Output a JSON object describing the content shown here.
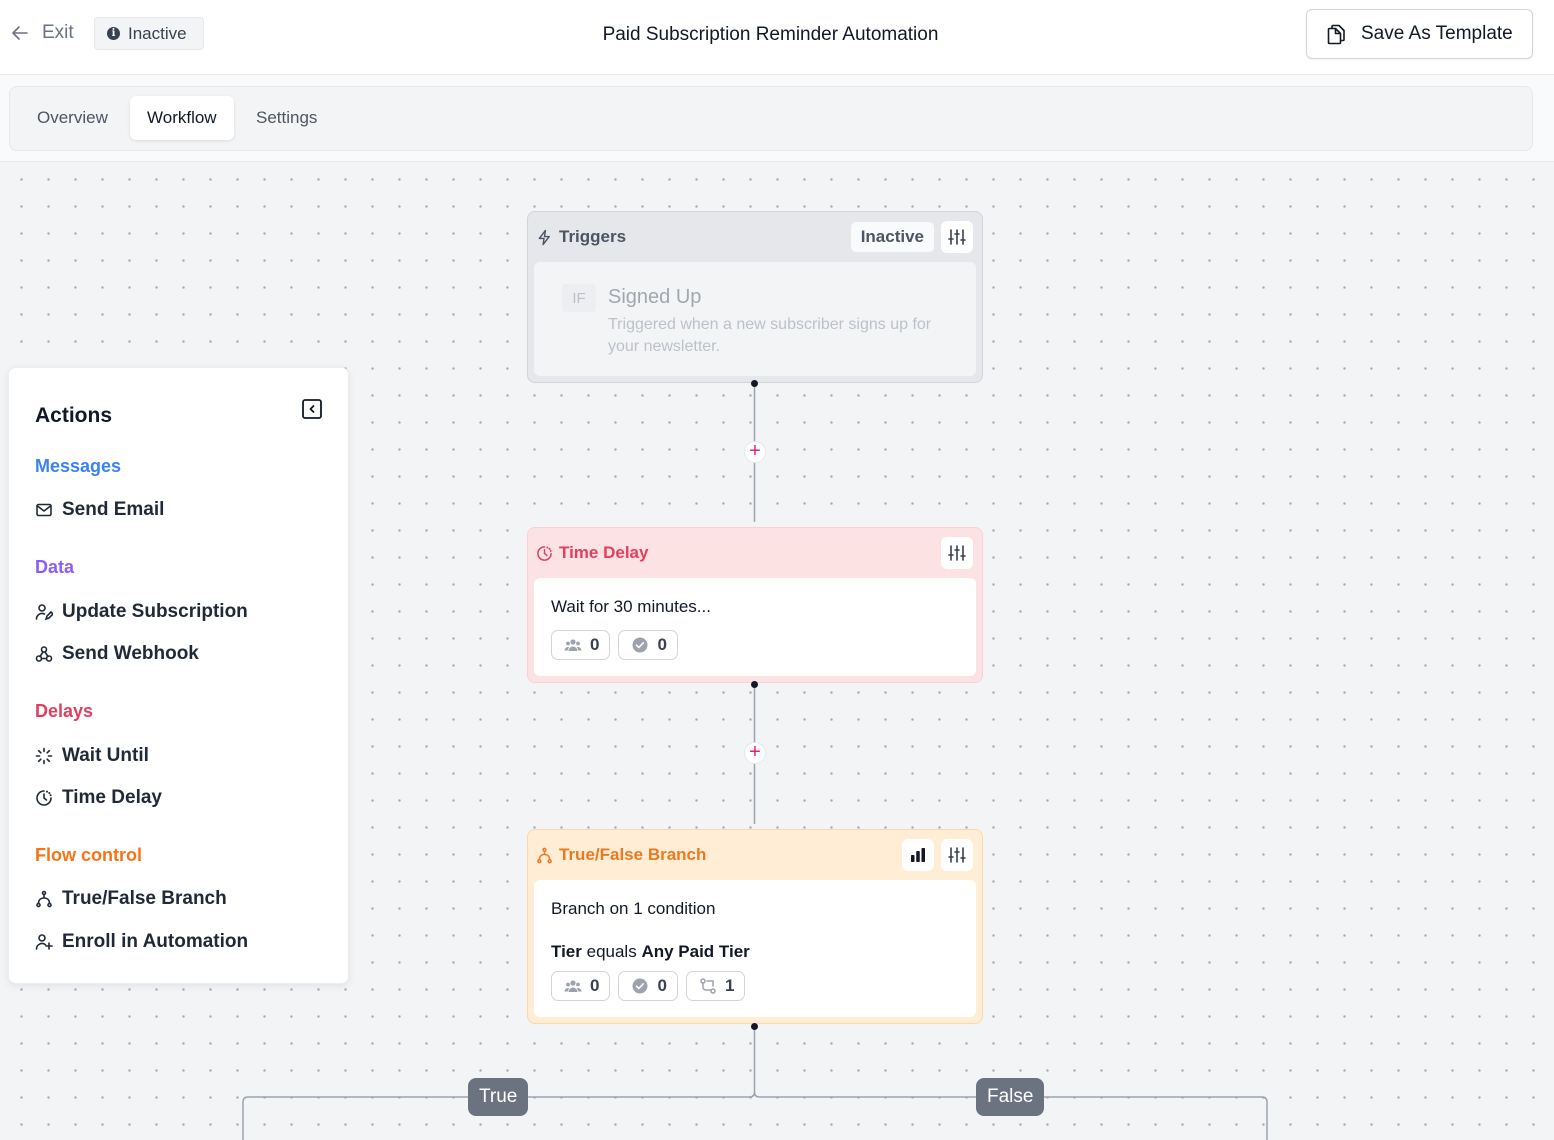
{
  "header": {
    "exit_label": "Exit",
    "status": "Inactive",
    "title": "Paid Subscription Reminder Automation",
    "save_template_label": "Save As Template"
  },
  "tabs": [
    {
      "label": "Overview",
      "active": false
    },
    {
      "label": "Workflow",
      "active": true
    },
    {
      "label": "Settings",
      "active": false
    }
  ],
  "actions_panel": {
    "title": "Actions",
    "groups": [
      {
        "title": "Messages",
        "color": "#3b82f6",
        "items": [
          {
            "label": "Send Email",
            "icon": "mail-icon"
          }
        ]
      },
      {
        "title": "Data",
        "color": "#8b5cf6",
        "items": [
          {
            "label": "Update Subscription",
            "icon": "user-edit-icon"
          },
          {
            "label": "Send Webhook",
            "icon": "webhook-icon"
          }
        ]
      },
      {
        "title": "Delays",
        "color": "#e0405e",
        "items": [
          {
            "label": "Wait Until",
            "icon": "loader-icon"
          },
          {
            "label": "Time Delay",
            "icon": "clock-icon"
          }
        ]
      },
      {
        "title": "Flow control",
        "color": "#f97316",
        "items": [
          {
            "label": "True/False Branch",
            "icon": "branch-icon"
          },
          {
            "label": "Enroll in Automation",
            "icon": "user-plus-icon"
          }
        ]
      }
    ]
  },
  "workflow": {
    "trigger": {
      "title": "Triggers",
      "status": "Inactive",
      "if_tag": "IF",
      "event_title": "Signed Up",
      "event_description": "Triggered when a new subscriber signs up for your newsletter."
    },
    "delay": {
      "title": "Time Delay",
      "text": "Wait for 30 minutes...",
      "stats": {
        "enrolled": "0",
        "completed": "0"
      }
    },
    "branch": {
      "title": "True/False Branch",
      "text": "Branch on 1 condition",
      "condition_field": "Tier",
      "condition_operator": "equals",
      "condition_value": "Any Paid Tier",
      "stats": {
        "enrolled": "0",
        "completed": "0",
        "branched": "1"
      },
      "true_label": "True",
      "false_label": "False"
    }
  },
  "colors": {
    "delay_accent": "#e0405e",
    "branch_accent": "#ea7a1f",
    "plus_accent": "#e11d74"
  }
}
